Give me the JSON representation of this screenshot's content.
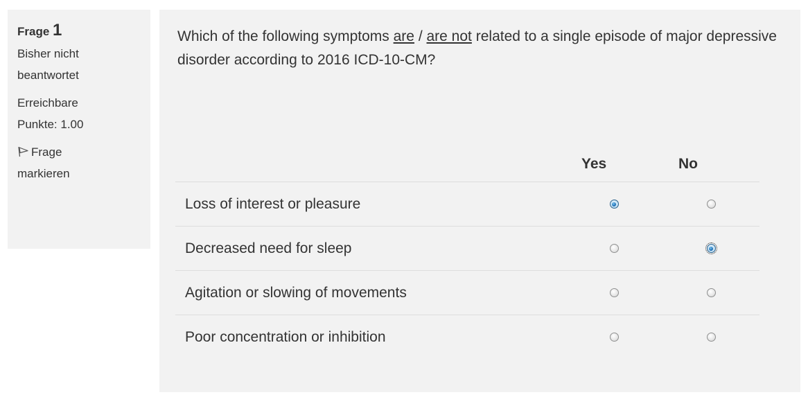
{
  "info": {
    "frage_word": "Frage",
    "frage_number": "1",
    "status_line1": "Bisher nicht",
    "status_line2": "beantwortet",
    "points_line1": "Erreichbare",
    "points_line2": "Punkte: 1.00",
    "flag_label_line1": "Frage",
    "flag_label_line2": "markieren",
    "flag_icon": "flag-icon"
  },
  "question": {
    "part1": "Which of the following symptoms ",
    "are": "are",
    "sep": " / ",
    "are_not": "are not",
    "part2": " related to a single episode of major depressive disorder according to 2016 ICD-10-CM?"
  },
  "table": {
    "col_yes": "Yes",
    "col_no": "No",
    "rows": [
      {
        "label": "Loss of interest or pleasure",
        "selected": "yes"
      },
      {
        "label": "Decreased need for sleep",
        "selected": "no"
      },
      {
        "label": "Agitation or slowing of movements",
        "selected": ""
      },
      {
        "label": "Poor concentration or inhibition",
        "selected": ""
      }
    ]
  },
  "colors": {
    "panel_bg": "#f2f2f2",
    "text": "#333333",
    "radio_checked": "#1f6fb5"
  }
}
